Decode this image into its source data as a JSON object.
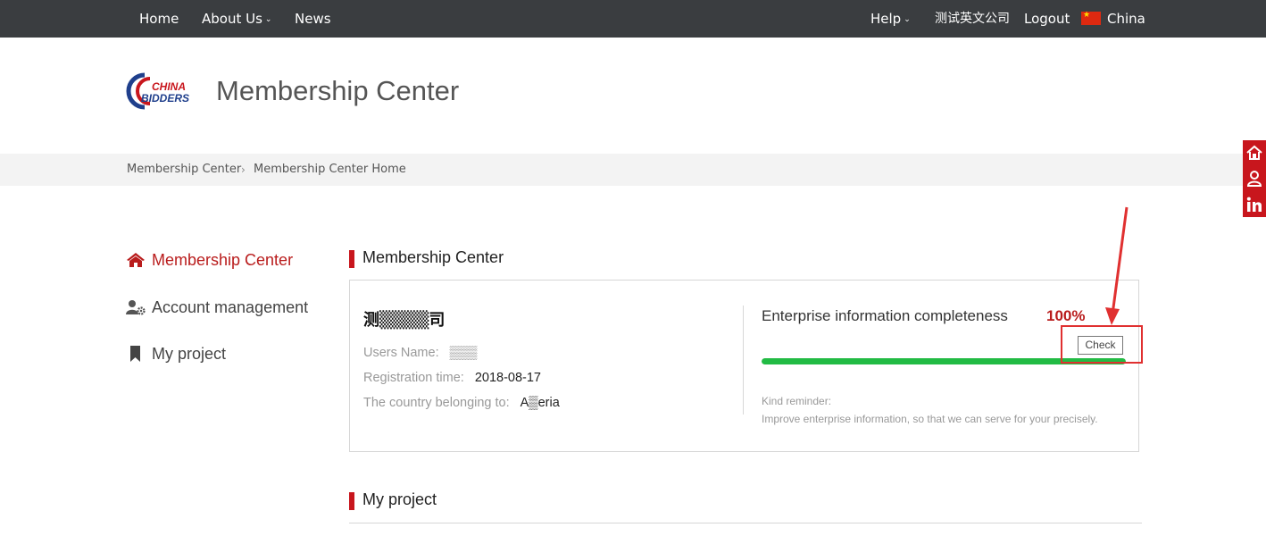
{
  "topnav": {
    "home": "Home",
    "about": "About Us",
    "news": "News",
    "help": "Help",
    "company": "测试英文公司",
    "logout": "Logout",
    "region": "China"
  },
  "logo": {
    "line1": "CHINA",
    "line2": "BIDDERS"
  },
  "header": {
    "title": "Membership Center"
  },
  "breadcrumb": {
    "item1": "Membership Center",
    "item2": "Membership Center Home"
  },
  "sidebar": {
    "items": [
      {
        "label": "Membership Center",
        "icon": "home-icon",
        "active": true
      },
      {
        "label": "Account management",
        "icon": "user-gear-icon",
        "active": false
      },
      {
        "label": "My project",
        "icon": "bookmark-icon",
        "active": false
      }
    ]
  },
  "sections": {
    "membership": "Membership Center",
    "project": "My project"
  },
  "profile": {
    "company_name": "测▒▒▒▒司",
    "users_name_label": "Users Name:",
    "users_name_value": "▒▒▒",
    "reg_label": "Registration time:",
    "reg_value": "2018-08-17",
    "country_label": "The country belonging to:",
    "country_value": "A▒eria"
  },
  "completeness": {
    "label": "Enterprise information completeness",
    "percent_text": "100%",
    "percent": 100,
    "check_label": "Check",
    "reminder_title": "Kind reminder:",
    "reminder_text": "Improve enterprise information, so that we can serve for your precisely."
  },
  "floating_sidebar": {
    "icons": [
      "home-icon",
      "user-icon",
      "linkedin-icon"
    ]
  },
  "colors": {
    "accent": "#c8161d",
    "progress": "#22bb44",
    "topbar": "#3a3d40"
  }
}
